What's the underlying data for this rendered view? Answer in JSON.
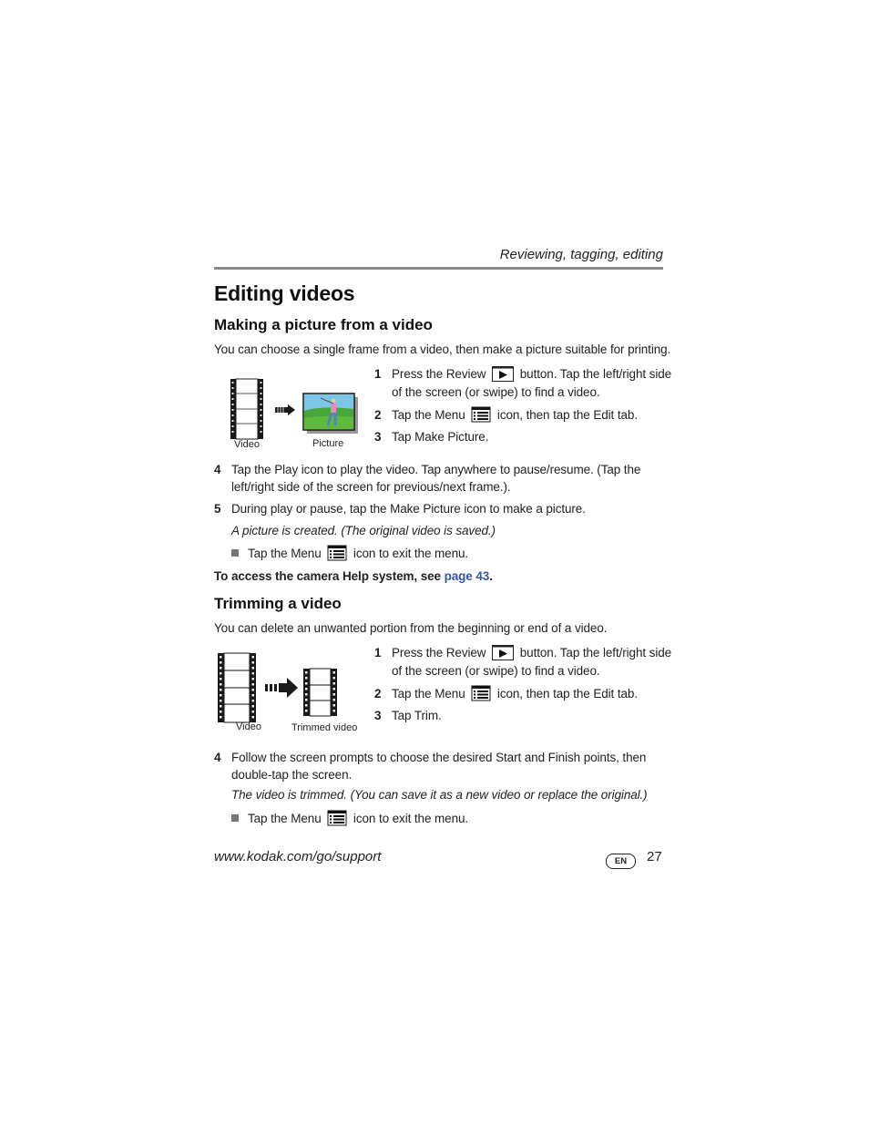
{
  "header": {
    "section": "Reviewing, tagging, editing"
  },
  "title": "Editing videos",
  "making_picture": {
    "heading": "Making a picture from a video",
    "intro": "You can choose a single frame from a video, then make a picture suitable for printing.",
    "figure": {
      "left_caption": "Video",
      "right_caption": "Picture"
    },
    "steps": [
      {
        "num": "1",
        "line1_before": "Press the Review",
        "line1_after": "button. Tap the left/right side",
        "line2": "of the screen (or swipe) to find a video."
      },
      {
        "num": "2",
        "before": "Tap the Menu",
        "after": "icon, then tap the Edit tab."
      },
      {
        "num": "3",
        "text": "Tap Make Picture."
      },
      {
        "num": "4",
        "line1": "Tap the Play icon to play the video. Tap anywhere to pause/resume. (Tap the",
        "line2": "left/right side of the screen for previous/next frame.)."
      },
      {
        "num": "5",
        "text": "During play or pause, tap the Make Picture icon to make a picture."
      }
    ],
    "result_note": "A picture is created. (The original video is saved.)",
    "bullet": {
      "before": "Tap the Menu",
      "after": "icon to exit the menu."
    },
    "help": {
      "text": "To access the camera Help system, see ",
      "link": "page 43",
      "end": "."
    }
  },
  "trimming": {
    "heading": "Trimming a video",
    "intro": "You can delete an unwanted portion from the beginning or end of a video.",
    "figure": {
      "left_caption": "Video",
      "right_caption": "Trimmed video"
    },
    "steps": [
      {
        "num": "1",
        "line1_before": "Press the Review",
        "line1_after": "button. Tap the left/right side",
        "line2": "of the screen (or swipe) to find a video."
      },
      {
        "num": "2",
        "before": "Tap the Menu",
        "after": "icon, then tap the Edit tab."
      },
      {
        "num": "3",
        "text": "Tap Trim."
      },
      {
        "num": "4",
        "line1": "Follow the screen prompts to choose the desired Start and Finish points, then",
        "line2": "double-tap the screen."
      }
    ],
    "result_note": "The video is trimmed. (You can save it as a new video or replace the original.)",
    "bullet": {
      "before": "Tap the Menu",
      "after": "icon to exit the menu."
    }
  },
  "footer": {
    "url": "www.kodak.com/go/support",
    "language_badge": "EN",
    "page_number": "27"
  },
  "colors": {
    "link": "#3355aa",
    "rule": "#8a8a8a"
  }
}
